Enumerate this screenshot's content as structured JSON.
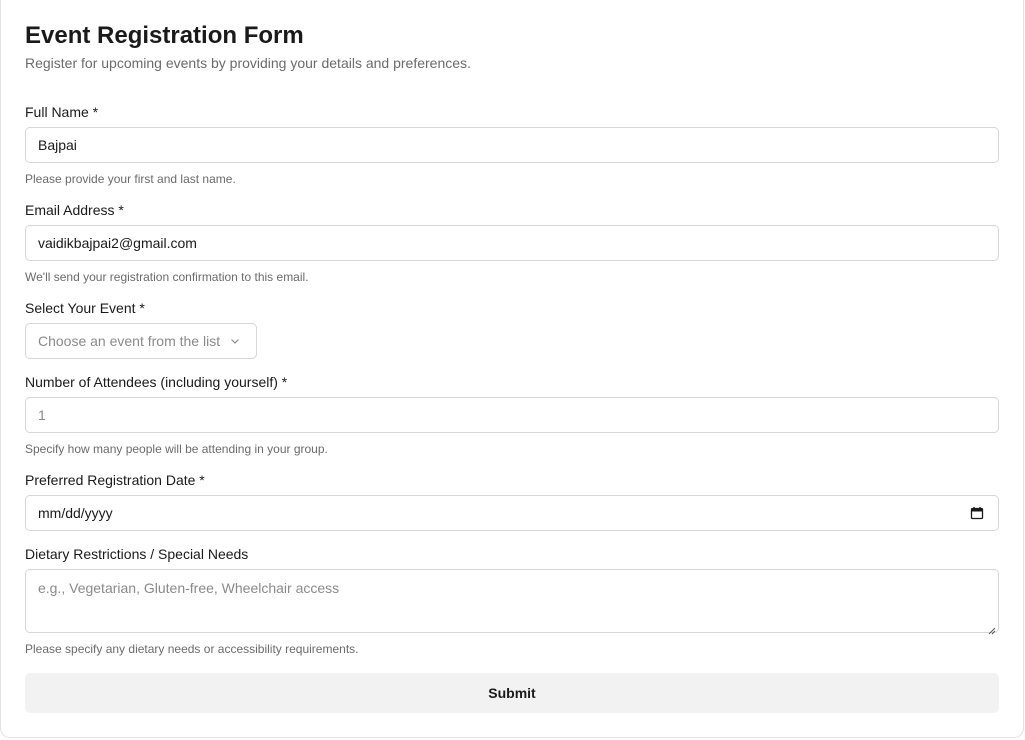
{
  "form": {
    "title": "Event Registration Form",
    "subtitle": "Register for upcoming events by providing your details and preferences."
  },
  "fields": {
    "full_name": {
      "label": "Full Name *",
      "value": "Bajpai",
      "help": "Please provide your first and last name."
    },
    "email": {
      "label": "Email Address *",
      "value": "vaidikbajpai2@gmail.com",
      "help": "We'll send your registration confirmation to this email."
    },
    "event": {
      "label": "Select Your Event *",
      "placeholder": "Choose an event from the list"
    },
    "attendees": {
      "label": "Number of Attendees (including yourself) *",
      "placeholder": "1",
      "help": "Specify how many people will be attending in your group."
    },
    "date": {
      "label": "Preferred Registration Date *",
      "value": "mm/dd/yyyy"
    },
    "dietary": {
      "label": "Dietary Restrictions / Special Needs",
      "placeholder": "e.g., Vegetarian, Gluten-free, Wheelchair access",
      "help": "Please specify any dietary needs or accessibility requirements."
    }
  },
  "submit_label": "Submit",
  "icons": {
    "select": "chevron-down-icon",
    "date": "calendar-icon",
    "textarea": "resize-handle-icon"
  }
}
